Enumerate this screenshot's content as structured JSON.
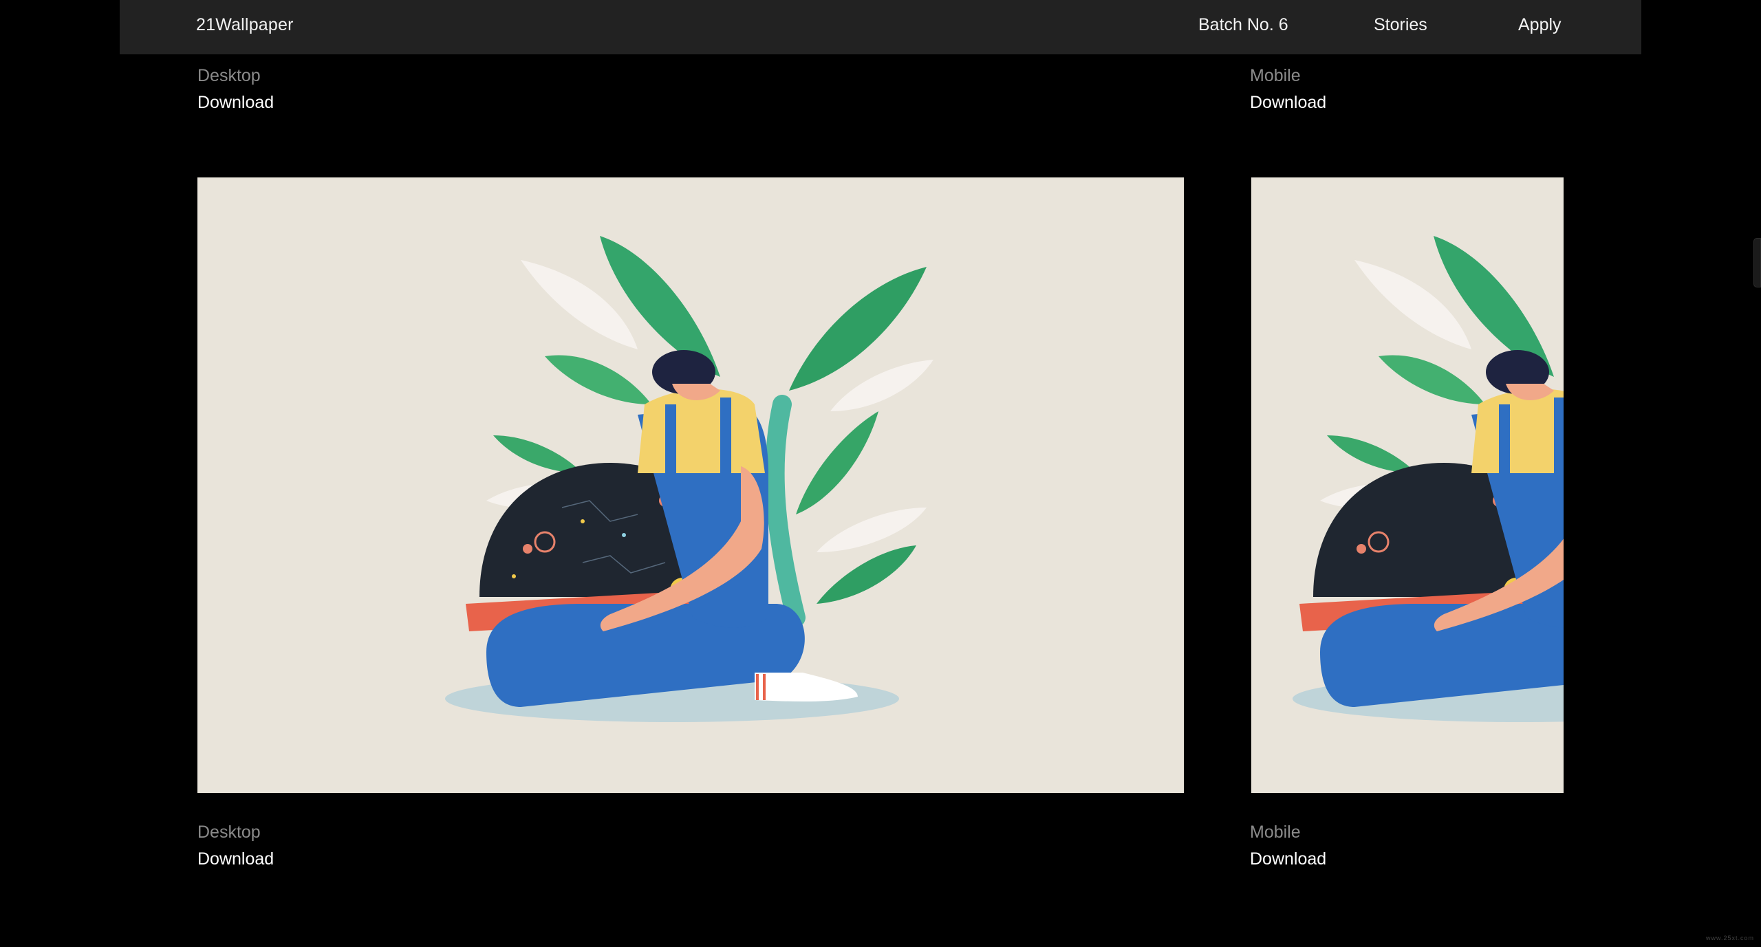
{
  "nav": {
    "brand": "21Wallpaper",
    "links": [
      "Batch No. 6",
      "Stories",
      "Apply"
    ]
  },
  "top_section": {
    "desktop_label": "Desktop",
    "desktop_download": "Download",
    "mobile_label": "Mobile",
    "mobile_download": "Download"
  },
  "wallpaper": {
    "illustration": "person-sitting-with-galaxy-dome-and-plants",
    "background_color": "#e9e4da"
  },
  "bottom_section": {
    "desktop_label": "Desktop",
    "desktop_download": "Download",
    "mobile_label": "Mobile",
    "mobile_download": "Download"
  },
  "watermark": "www.25xt.com"
}
